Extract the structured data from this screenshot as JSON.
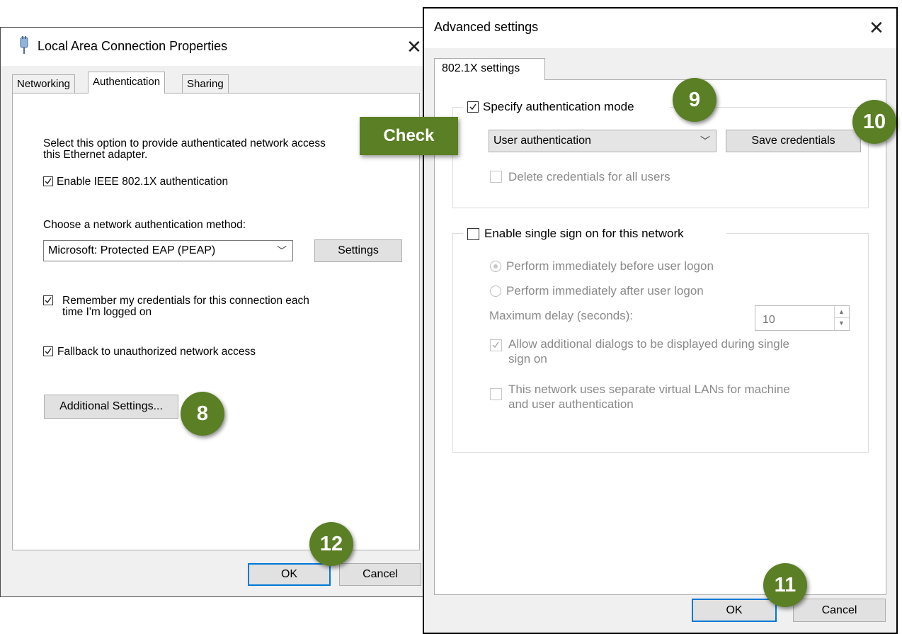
{
  "left_dialog": {
    "title": "Local Area Connection Properties",
    "tabs": [
      "Networking",
      "Authentication",
      "Sharing"
    ],
    "selected_tab": "Authentication",
    "description_line1": "Select this option to provide authenticated network access",
    "description_line2": "this Ethernet adapter.",
    "enable_8021x": {
      "label": "Enable IEEE 802.1X authentication",
      "checked": true
    },
    "choose_method_label": "Choose a network authentication method:",
    "method_value": "Microsoft: Protected EAP (PEAP)",
    "settings_button": "Settings",
    "remember_line1": "Remember my credentials for this connection each",
    "remember_line2": "time I'm logged on",
    "fallback_label": "Fallback to unauthorized network access",
    "additional_settings_button": "Additional Settings...",
    "ok_button": "OK",
    "cancel_button": "Cancel"
  },
  "right_dialog": {
    "title": "Advanced settings",
    "tab": "802.1X settings",
    "specify_mode": {
      "label": "Specify authentication mode",
      "checked": true
    },
    "mode_value": "User authentication",
    "save_credentials_button": "Save credentials",
    "delete_credentials_label": "Delete credentials for all users",
    "sso_label": "Enable single sign on for this network",
    "perform_before_label": "Perform immediately before user logon",
    "perform_after_label": "Perform immediately after user logon",
    "max_delay_label": "Maximum delay (seconds):",
    "max_delay_value": "10",
    "allow_dialogs_line1": "Allow additional dialogs to be displayed during single",
    "allow_dialogs_line2": "sign on",
    "vlan_line1": "This network uses separate virtual LANs for machine",
    "vlan_line2": "and user authentication",
    "ok_button": "OK",
    "cancel_button": "Cancel"
  },
  "annotations": {
    "callout": "Check",
    "step8": "8",
    "step9": "9",
    "step10": "10",
    "step11": "11",
    "step12": "12",
    "badge_color": "#5a7f24"
  },
  "icons": [
    "plug-icon",
    "close-icon",
    "chevron-down-icon",
    "checkmark-icon",
    "spin-up-icon",
    "spin-down-icon"
  ]
}
